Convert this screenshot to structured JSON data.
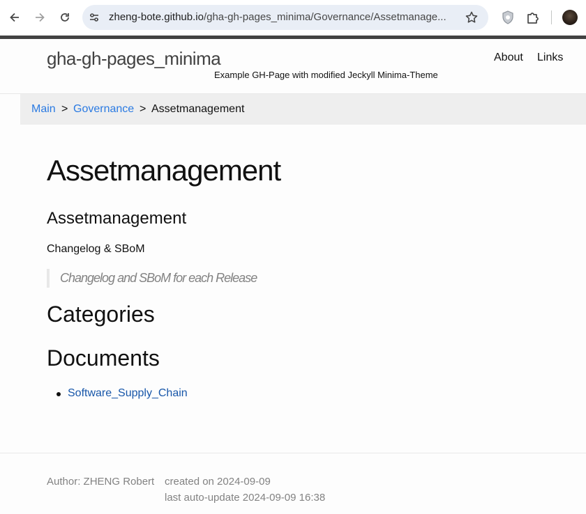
{
  "browser": {
    "url_host": "zheng-bote.github.io",
    "url_path": "/gha-gh-pages_minima/Governance/Assetmanage...",
    "icons": [
      "back-arrow-icon",
      "forward-arrow-icon",
      "reload-icon",
      "tune-icon",
      "star-icon",
      "shield-extension-icon",
      "puzzle-icon",
      "profile-avatar"
    ]
  },
  "header": {
    "site_title": "gha-gh-pages_minima",
    "site_description": "Example GH-Page with modified Jeckyll Minima-Theme",
    "nav": [
      {
        "label": "About"
      },
      {
        "label": "Links"
      }
    ]
  },
  "breadcrumb": {
    "items": [
      {
        "label": "Main"
      },
      {
        "label": "Governance"
      },
      {
        "label": "Assetmanagement"
      }
    ],
    "separator": ">"
  },
  "content": {
    "title": "Assetmanagement",
    "subtitle": "Assetmanagement",
    "paragraph": "Changelog & SBoM",
    "quote": "Changelog and SBoM for each Release",
    "categories_heading": "Categories",
    "documents_heading": "Documents",
    "documents": [
      {
        "label": "Software_Supply_Chain"
      }
    ]
  },
  "footer": {
    "author": "Author: ZHENG Robert",
    "created": "created on 2024-09-09",
    "updated": "last auto-update 2024-09-09 16:38"
  },
  "colors": {
    "link": "#2a7ae2",
    "breadcrumb_bg": "#eeeeee",
    "header_border": "#424242",
    "muted": "#828282"
  }
}
